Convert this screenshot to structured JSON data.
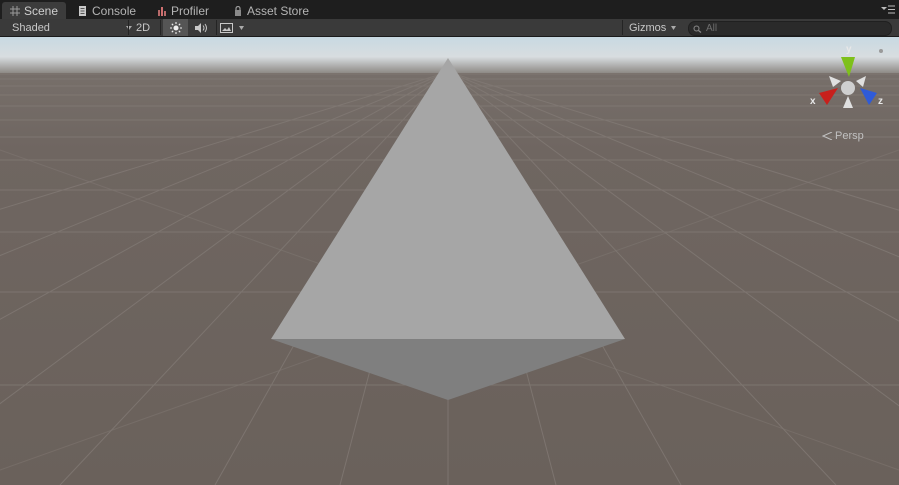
{
  "tabs": [
    {
      "label": "Scene",
      "icon": "grid-icon",
      "active": true
    },
    {
      "label": "Console",
      "icon": "console-icon",
      "active": false
    },
    {
      "label": "Profiler",
      "icon": "profiler-icon",
      "active": false
    },
    {
      "label": "Asset Store",
      "icon": "lock-icon",
      "active": false
    }
  ],
  "toolbar": {
    "draw_mode": "Shaded",
    "mode_2d": "2D",
    "lighting_icon": "sun-icon",
    "audio_icon": "speaker-icon",
    "effects_icon": "image-icon",
    "gizmos_label": "Gizmos",
    "search_placeholder": "All"
  },
  "gizmo": {
    "y_label": "y",
    "x_label": "x",
    "z_label": "z",
    "projection_label": "Persp"
  },
  "colors": {
    "tab_bg": "#1e1e1e",
    "toolbar_bg": "#3a3a3a",
    "ground": "#6e655f",
    "sky_top": "#c8d9e2",
    "pyramid_face": "#a6a6a6",
    "pyramid_bottom": "#808080",
    "axis_x": "#c8201c",
    "axis_y": "#7ec01a",
    "axis_z": "#2f5bd8"
  }
}
